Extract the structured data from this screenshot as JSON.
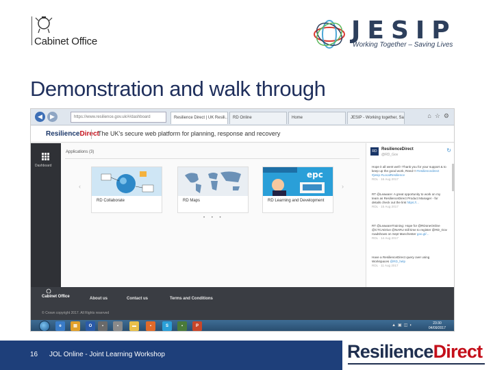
{
  "slide": {
    "cabinet_office": "Cabinet Office",
    "jesip_word": "JESIP",
    "jesip_tagline": "Working Together – Saving Lives",
    "title": "Demonstration and walk through",
    "page_number": "16",
    "footer_text": "JOL Online - Joint Learning Workshop",
    "brand_left": "Resilience",
    "brand_right": "Direct"
  },
  "browser": {
    "address": "https://www.resilience.gov.uk/#/dashboard",
    "tabs": [
      {
        "label": "Resilience Direct | UK Resili..."
      },
      {
        "label": "RD Online"
      },
      {
        "label": "Home"
      },
      {
        "label": "JESIP - Working together, Savi..."
      }
    ]
  },
  "rd_header": {
    "logo_left": "Resilience",
    "logo_right": "Direct",
    "tagline": "The UK's secure web platform for planning, response and recovery"
  },
  "sidebar": {
    "label": "Dashboard"
  },
  "apps": {
    "title": "Applications (3)",
    "cards": [
      {
        "label": "RD Collaborate"
      },
      {
        "label": "RD Maps"
      },
      {
        "label": "RD Learning and Development"
      }
    ],
    "pager": "• • •"
  },
  "twitter": {
    "name": "ResilienceDirect",
    "handle": "@RD_Gov",
    "tweets": [
      {
        "text": "Hope it all went well ! Thank you for your support & to keep up the good work, Reed !!",
        "link": "#resiliencedirect #jesip #LocalResilience",
        "meta": "RDL · 16 Aug 2017"
      },
      {
        "text": "RT @Leaware: A great opportunity to work on my team as ResilienceDirect Product Manager - for details check out the link",
        "link": "https://...",
        "meta": "RDL · 15 Aug 2017"
      },
      {
        "text": "RT @LeawareTraining: Hope for @RDoneOnline @CTCADrive @NARU still time to register @RD_Gov roadshows on Sept Manchester",
        "link": "goo.gl/...",
        "meta": "RDL · 14 Aug 2017"
      },
      {
        "text": "Have a ResilienceDirect query over using Workspaces ",
        "link": "@RD_help",
        "meta": "RDL · 11 Aug 2017"
      }
    ]
  },
  "footer": {
    "logo": "Cabinet Office",
    "links": [
      "About us",
      "Contact us",
      "Terms and Conditions"
    ],
    "copyright": "© Crown copyright 2017. All Rights reserved"
  },
  "taskbar": {
    "time": "23:30",
    "date": "04/09/2017"
  },
  "colors": {
    "navy": "#1e3f7a",
    "title": "#1f2f5c",
    "rd_red": "#c40f1a"
  }
}
